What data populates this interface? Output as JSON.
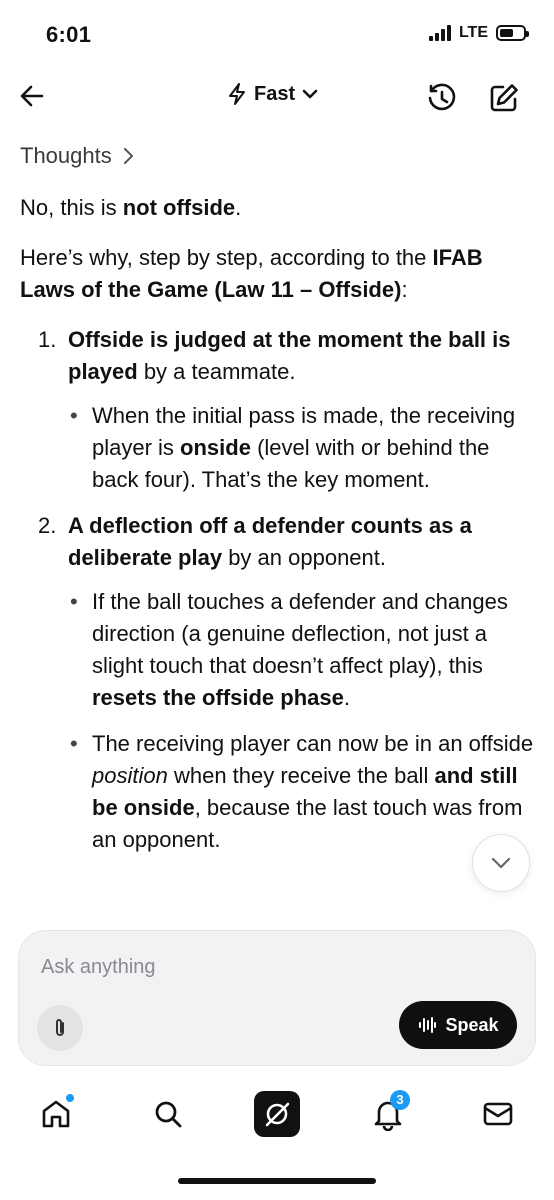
{
  "status": {
    "time": "6:01",
    "network": "LTE"
  },
  "nav": {
    "model_label": "Fast"
  },
  "content": {
    "thoughts_label": "Thoughts",
    "intro": {
      "t1": "No, this is ",
      "b1": "not offside",
      "t2": "."
    },
    "why": {
      "t1": "Here’s why, step by step, according to the ",
      "b1": "IFAB Laws of the Game (Law 11 – Offside)",
      "t2": ":"
    },
    "steps": [
      {
        "num": "1.",
        "b1": "Offside is judged at the moment the ball is played",
        "t1": " by a teammate.",
        "bullets": [
          {
            "t1": "When the initial pass is made, the receiving player is ",
            "b1": "onside",
            "t2": " (level with or behind the back four). That’s the key moment."
          }
        ]
      },
      {
        "num": "2.",
        "b1": "A deflection off a defender counts as a deliberate play",
        "t1": " by an opponent.",
        "bullets": [
          {
            "t1": "If the ball touches a defender and changes direction (a genuine deflection, not just a slight touch that doesn’t affect play), this ",
            "b1": "resets the offside phase",
            "t2": "."
          },
          {
            "t1": "The receiving player can now be in an offside ",
            "i1": "position",
            "t2": " when they receive the ball ",
            "b1": "and still be onside",
            "t3": ", because the last touch was from an opponent."
          }
        ]
      }
    ]
  },
  "composer": {
    "placeholder": "Ask anything",
    "speak_label": "Speak"
  },
  "tabs": {
    "notifications_badge": "3"
  },
  "icons": {
    "back": "arrow-left-icon",
    "model": "lightning-icon",
    "history": "history-clock-icon",
    "compose": "edit-icon",
    "attach": "paperclip-icon",
    "speak": "waveform-icon",
    "scroll": "chevron-down-icon",
    "home": "home-icon",
    "search": "search-icon",
    "grok": "grok-logo-icon",
    "notifications": "bell-icon",
    "messages": "mail-icon"
  },
  "colors": {
    "accent": "#1d9bf0",
    "text": "#111111",
    "composer_bg": "#f2f2f4"
  }
}
